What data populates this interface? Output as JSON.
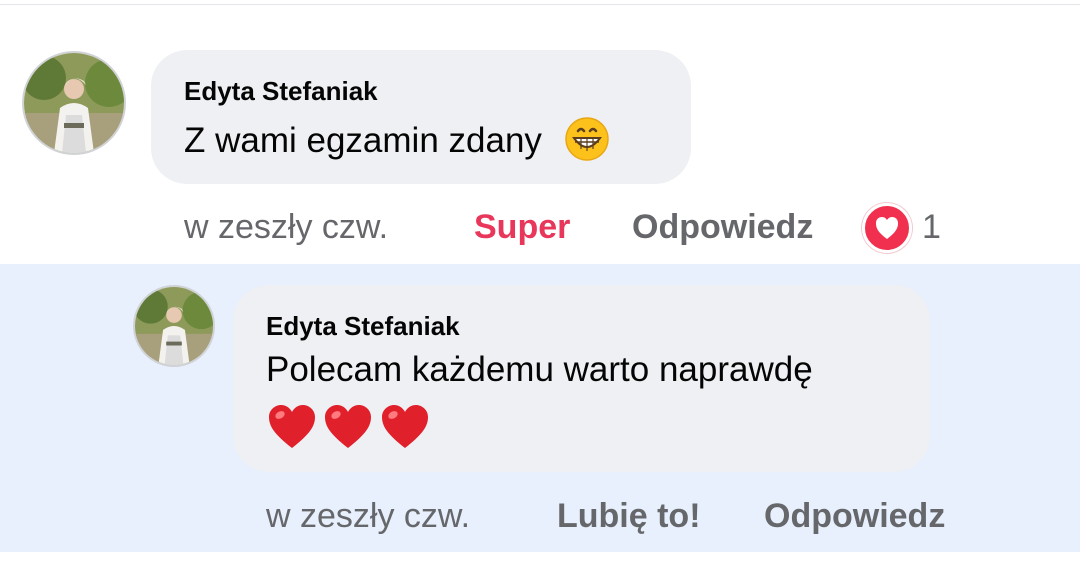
{
  "comments": [
    {
      "author": "Edyta Stefaniak",
      "text": "Z wami egzamin zdany",
      "emoji": "grinning-face-icon",
      "time": "w zeszły czw.",
      "like_label": "Super",
      "reply_label": "Odpowiedz",
      "reaction": {
        "type": "love",
        "count": "1"
      }
    }
  ],
  "reply": {
    "author": "Edyta Stefaniak",
    "text": "Polecam każdemu warto naprawdę",
    "emoji": [
      "red-heart-icon",
      "red-heart-icon",
      "red-heart-icon"
    ],
    "time": "w zeszły czw.",
    "like_label": "Lubię to!",
    "reply_label": "Odpowiedz"
  },
  "colors": {
    "bubble": "#eff0f3",
    "reply_highlight": "#e7f0fc",
    "super_red": "#e8375a",
    "secondary_text": "#65676b"
  }
}
